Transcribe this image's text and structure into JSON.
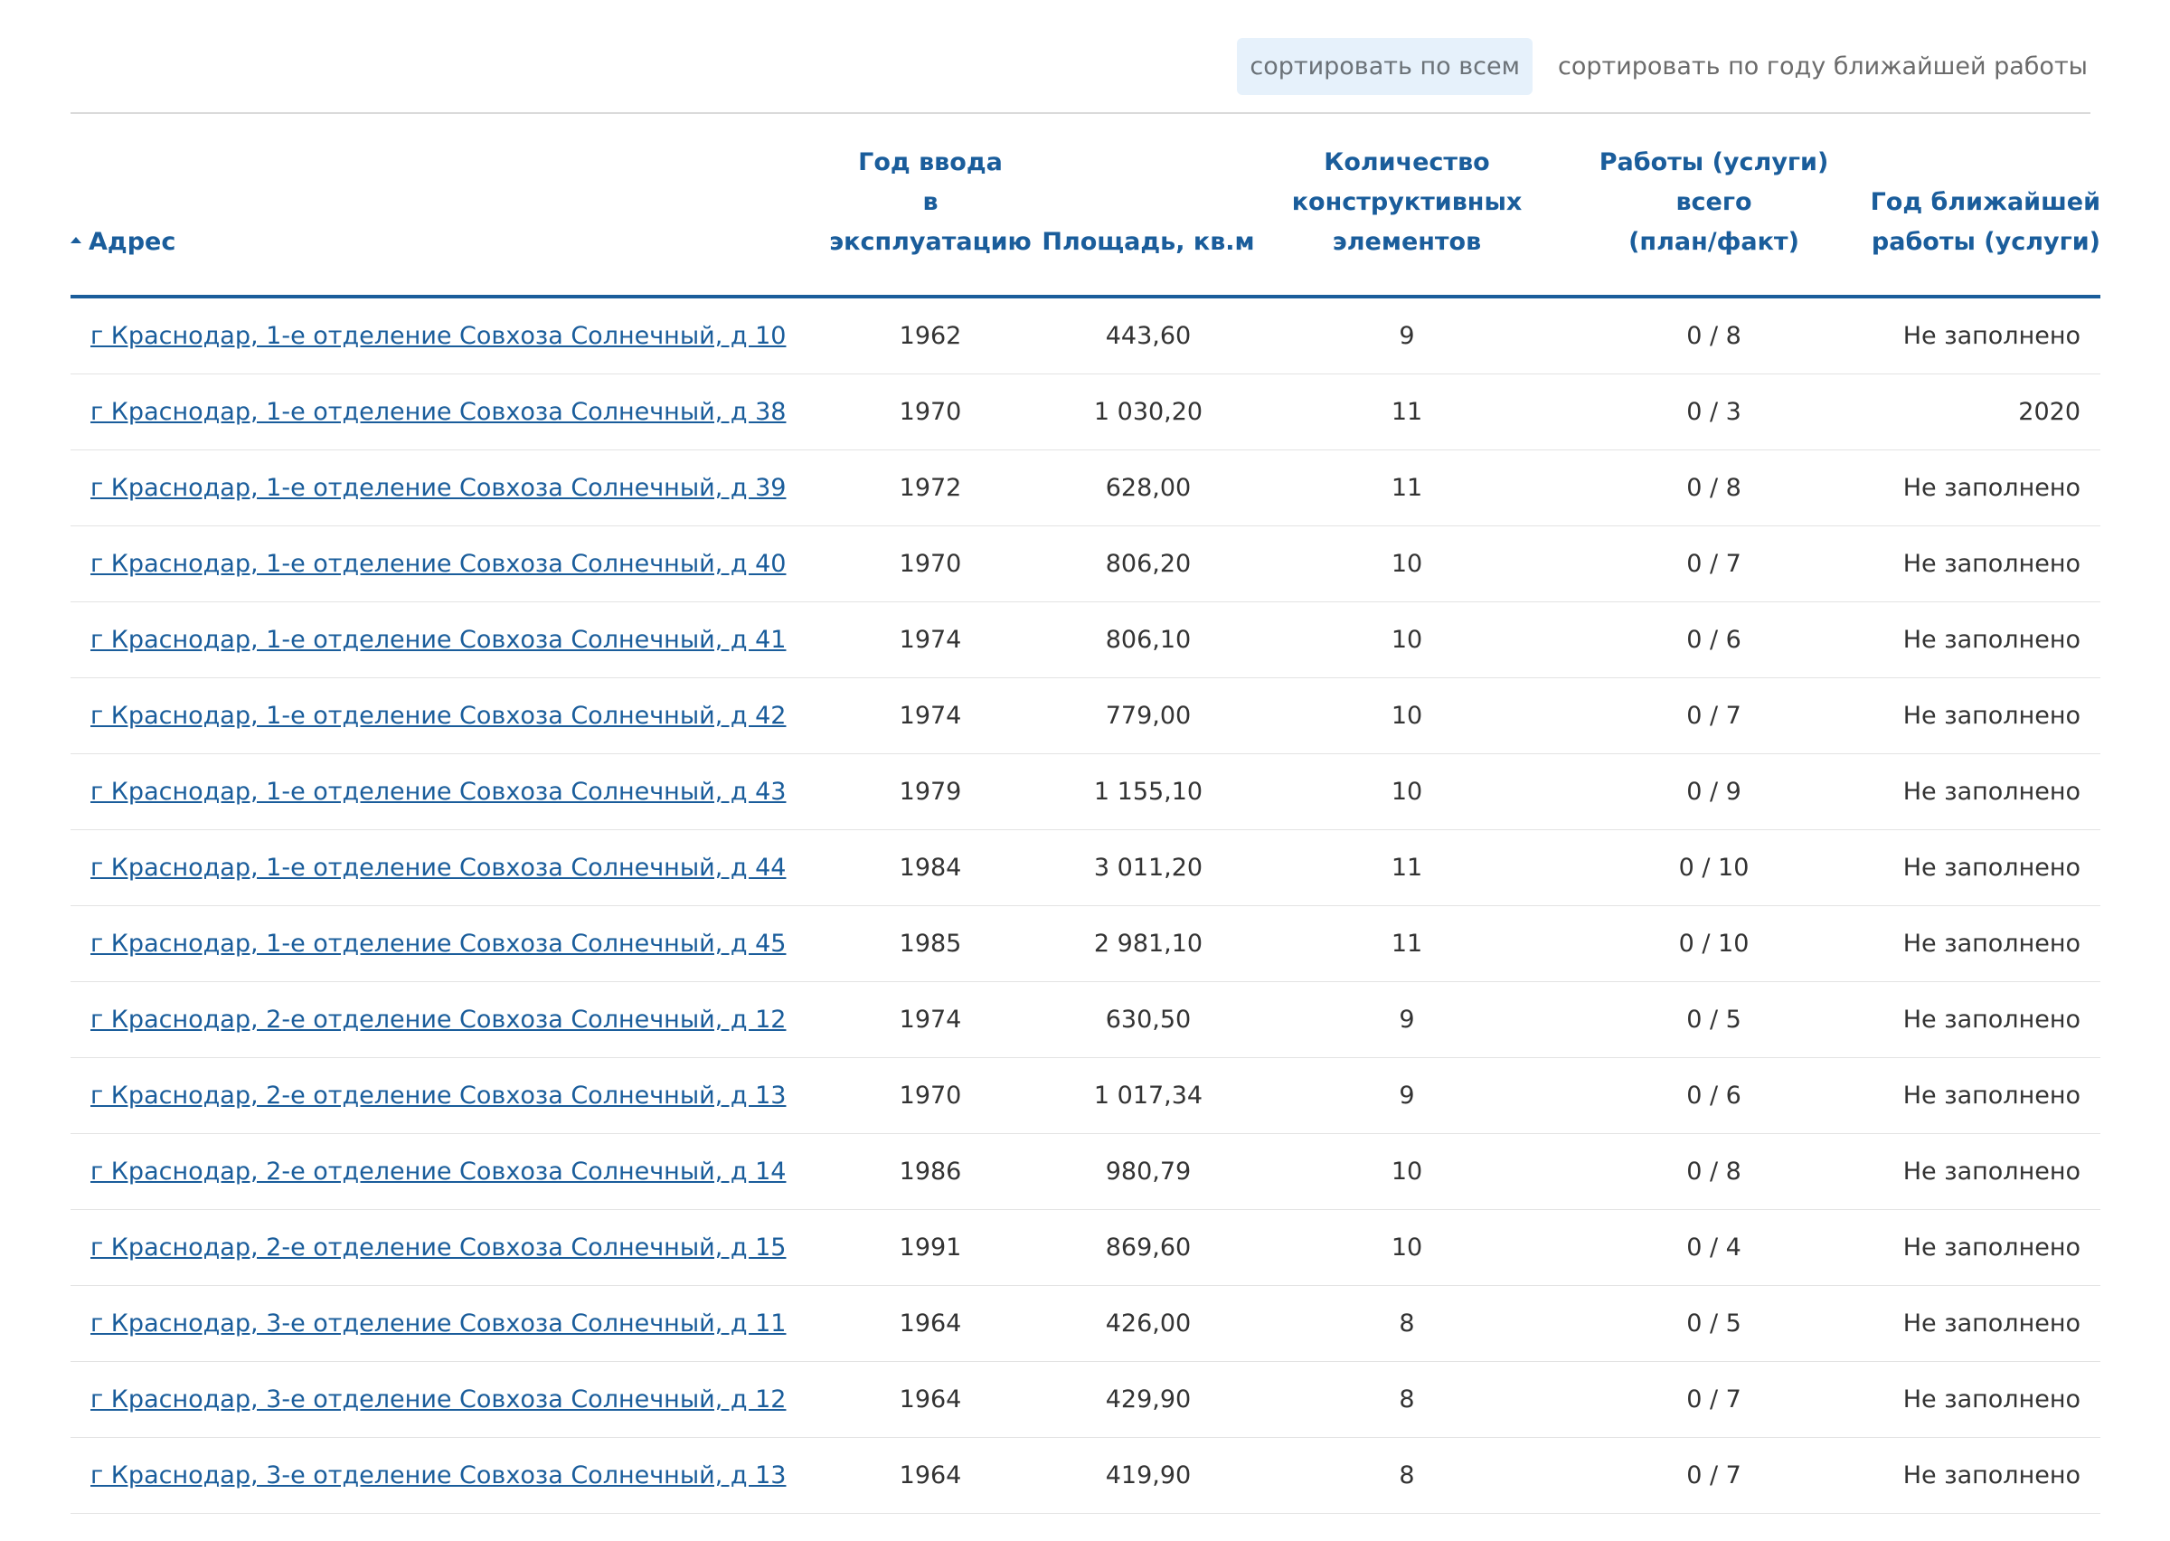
{
  "sort": {
    "by_all": "сортировать по всем",
    "by_next_year": "сортировать по году ближайшей работы"
  },
  "table": {
    "headers": {
      "address": "Адрес",
      "year_line1": "Год ввода",
      "year_line2": "в эксплуатацию",
      "area": "Площадь, кв.м",
      "count_line1": "Количество",
      "count_line2": "конструктивных",
      "count_line3": "элементов",
      "works_line1": "Работы (услуги) всего",
      "works_line2": "(план/факт)",
      "next_line1": "Год ближайшей",
      "next_line2": "работы (услуги)"
    },
    "rows": [
      {
        "address": "г Краснодар, 1-е отделение Совхоза Солнечный, д 10",
        "year": "1962",
        "area": "443,60",
        "count": "9",
        "works": "0 / 8",
        "next": "Не заполнено"
      },
      {
        "address": "г Краснодар, 1-е отделение Совхоза Солнечный, д 38",
        "year": "1970",
        "area": "1 030,20",
        "count": "11",
        "works": "0 / 3",
        "next": "2020"
      },
      {
        "address": "г Краснодар, 1-е отделение Совхоза Солнечный, д 39",
        "year": "1972",
        "area": "628,00",
        "count": "11",
        "works": "0 / 8",
        "next": "Не заполнено"
      },
      {
        "address": "г Краснодар, 1-е отделение Совхоза Солнечный, д 40",
        "year": "1970",
        "area": "806,20",
        "count": "10",
        "works": "0 / 7",
        "next": "Не заполнено"
      },
      {
        "address": "г Краснодар, 1-е отделение Совхоза Солнечный, д 41",
        "year": "1974",
        "area": "806,10",
        "count": "10",
        "works": "0 / 6",
        "next": "Не заполнено"
      },
      {
        "address": "г Краснодар, 1-е отделение Совхоза Солнечный, д 42",
        "year": "1974",
        "area": "779,00",
        "count": "10",
        "works": "0 / 7",
        "next": "Не заполнено"
      },
      {
        "address": "г Краснодар, 1-е отделение Совхоза Солнечный, д 43",
        "year": "1979",
        "area": "1 155,10",
        "count": "10",
        "works": "0 / 9",
        "next": "Не заполнено"
      },
      {
        "address": "г Краснодар, 1-е отделение Совхоза Солнечный, д 44",
        "year": "1984",
        "area": "3 011,20",
        "count": "11",
        "works": "0 / 10",
        "next": "Не заполнено"
      },
      {
        "address": "г Краснодар, 1-е отделение Совхоза Солнечный, д 45",
        "year": "1985",
        "area": "2 981,10",
        "count": "11",
        "works": "0 / 10",
        "next": "Не заполнено"
      },
      {
        "address": "г Краснодар, 2-е отделение Совхоза Солнечный, д 12",
        "year": "1974",
        "area": "630,50",
        "count": "9",
        "works": "0 / 5",
        "next": "Не заполнено"
      },
      {
        "address": "г Краснодар, 2-е отделение Совхоза Солнечный, д 13",
        "year": "1970",
        "area": "1 017,34",
        "count": "9",
        "works": "0 / 6",
        "next": "Не заполнено"
      },
      {
        "address": "г Краснодар, 2-е отделение Совхоза Солнечный, д 14",
        "year": "1986",
        "area": "980,79",
        "count": "10",
        "works": "0 / 8",
        "next": "Не заполнено"
      },
      {
        "address": "г Краснодар, 2-е отделение Совхоза Солнечный, д 15",
        "year": "1991",
        "area": "869,60",
        "count": "10",
        "works": "0 / 4",
        "next": "Не заполнено"
      },
      {
        "address": "г Краснодар, 3-е отделение Совхоза Солнечный, д 11",
        "year": "1964",
        "area": "426,00",
        "count": "8",
        "works": "0 / 5",
        "next": "Не заполнено"
      },
      {
        "address": "г Краснодар, 3-е отделение Совхоза Солнечный, д 12",
        "year": "1964",
        "area": "429,90",
        "count": "8",
        "works": "0 / 7",
        "next": "Не заполнено"
      },
      {
        "address": "г Краснодар, 3-е отделение Совхоза Солнечный, д 13",
        "year": "1964",
        "area": "419,90",
        "count": "8",
        "works": "0 / 7",
        "next": "Не заполнено"
      }
    ]
  }
}
